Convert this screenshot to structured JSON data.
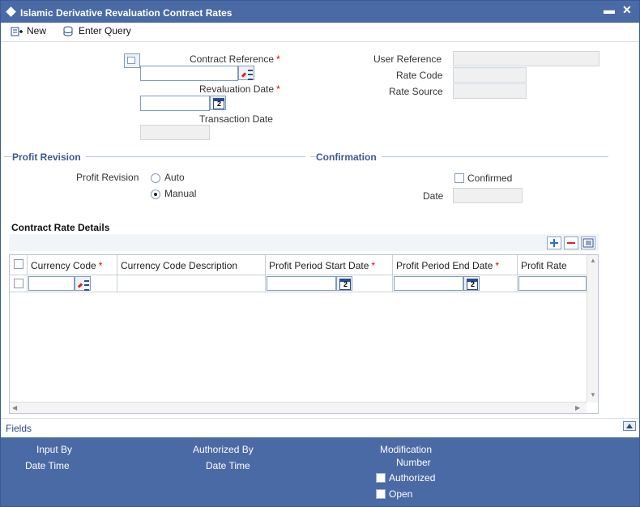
{
  "window": {
    "title": "Islamic Derivative Revaluation Contract Rates",
    "minimize": "▬",
    "close": "✕"
  },
  "toolbar": {
    "new_label": "New",
    "enter_query_label": "Enter Query"
  },
  "header": {
    "contract_reference_label": "Contract Reference",
    "revaluation_date_label": "Revaluation Date",
    "transaction_date_label": "Transaction Date",
    "user_reference_label": "User Reference",
    "rate_code_label": "Rate Code",
    "rate_source_label": "Rate Source",
    "required_mark": "*",
    "calendar_day": "2"
  },
  "profit_revision": {
    "section_title": "Profit Revision",
    "field_label": "Profit Revision",
    "options": [
      "Auto",
      "Manual"
    ],
    "selected": "Manual"
  },
  "confirmation": {
    "section_title": "Confirmation",
    "confirmed_label": "Confirmed",
    "confirmed": false,
    "date_label": "Date"
  },
  "rate_details": {
    "title": "Contract Rate Details",
    "columns": [
      {
        "label": "Currency Code",
        "required": true
      },
      {
        "label": "Currency Code Description",
        "required": false
      },
      {
        "label": "Profit Period Start Date",
        "required": true
      },
      {
        "label": "Profit Period End Date",
        "required": true
      },
      {
        "label": "Profit Rate",
        "required": false
      }
    ],
    "rows": [
      {
        "currency_code": "",
        "description": "",
        "start_date": "",
        "end_date": "",
        "profit_rate": ""
      }
    ]
  },
  "fields_bar": {
    "label": "Fields"
  },
  "footer": {
    "input_by": "Input By",
    "input_date_time": "Date Time",
    "authorized_by": "Authorized By",
    "auth_date_time": "Date Time",
    "modification": "Modification",
    "number": "Number",
    "authorized_label": "Authorized",
    "open_label": "Open"
  },
  "colors": {
    "title_bar": "#4a6aa5",
    "section_title": "#3b5998",
    "required": "#dd0000"
  }
}
